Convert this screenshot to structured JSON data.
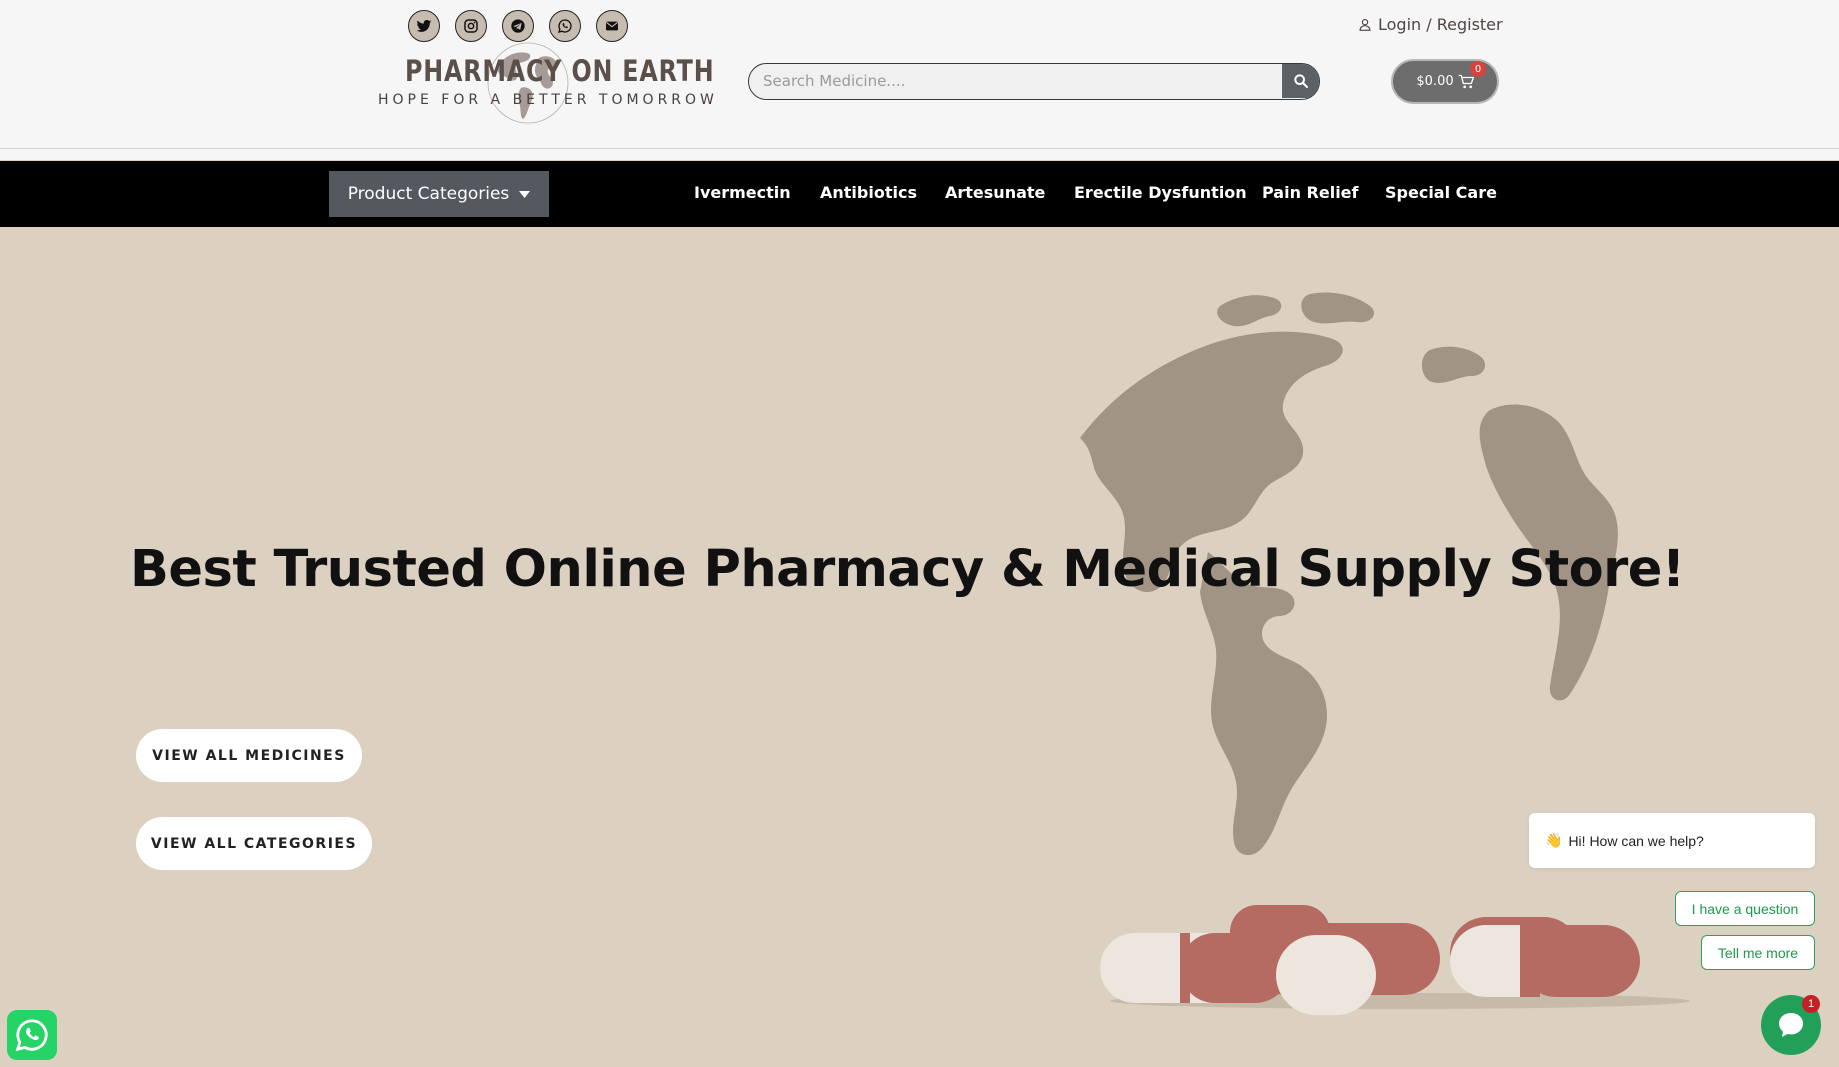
{
  "header": {
    "social_icons": [
      "twitter-icon",
      "instagram-icon",
      "telegram-icon",
      "whatsapp-icon",
      "envelope-icon"
    ],
    "logo": {
      "title": "PHARMACY ON EARTH",
      "subtitle": "HOPE FOR A BETTER TOMORROW"
    },
    "search": {
      "placeholder": "Search Medicine....",
      "icon": "search-icon"
    },
    "login_label": "Login / Register",
    "cart": {
      "total": "$0.00",
      "count": "0"
    }
  },
  "nav": {
    "categories_label": "Product Categories",
    "items": [
      "Ivermectin",
      "Antibiotics",
      "Artesunate",
      "Erectile Dysfuntion",
      "Pain Relief",
      "Special Care"
    ]
  },
  "hero": {
    "title": "Best Trusted Online Pharmacy & Medical Supply Store!",
    "buttons": [
      "VIEW ALL MEDICINES",
      "VIEW ALL CATEGORIES"
    ]
  },
  "chat": {
    "greeting_emoji": "👋",
    "greeting": "Hi! How can we help?",
    "options": [
      "I have a question",
      "Tell me more"
    ],
    "unread_count": "1"
  },
  "colors": {
    "hero_bg": "#dcd1c1",
    "nav_bg": "#000000",
    "category_button": "#54595f",
    "chat_green": "#22a05a",
    "logo_text": "#5b4f4a"
  }
}
